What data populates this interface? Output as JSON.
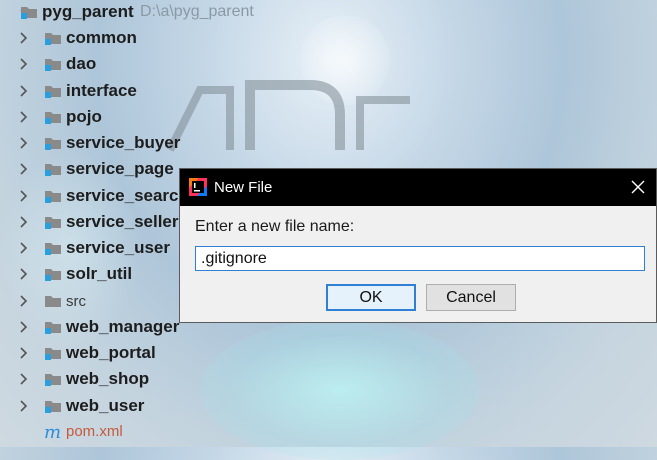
{
  "project": {
    "root_name": "pyg_parent",
    "root_path": "D:\\a\\pyg_parent",
    "modules": [
      {
        "name": "common"
      },
      {
        "name": "dao"
      },
      {
        "name": "interface"
      },
      {
        "name": "pojo"
      },
      {
        "name": "service_buyer"
      },
      {
        "name": "service_page"
      },
      {
        "name": "service_search"
      },
      {
        "name": "service_sellergoods"
      },
      {
        "name": "service_user"
      },
      {
        "name": "solr_util"
      }
    ],
    "src_folder": "src",
    "web_modules": [
      {
        "name": "web_manager"
      },
      {
        "name": "web_portal"
      },
      {
        "name": "web_shop"
      },
      {
        "name": "web_user"
      }
    ],
    "pom_file": "pom.xml",
    "pom_icon_letter": "m"
  },
  "dialog": {
    "title": "New File",
    "prompt": "Enter a new file name:",
    "input_value": ".gitignore",
    "ok_label": "OK",
    "cancel_label": "Cancel"
  },
  "colors": {
    "folder": "#8a8a8a",
    "module_badge": "#2a9fe0",
    "pom_text": "#c55a3c",
    "focus_accent": "#2f7fd4"
  }
}
